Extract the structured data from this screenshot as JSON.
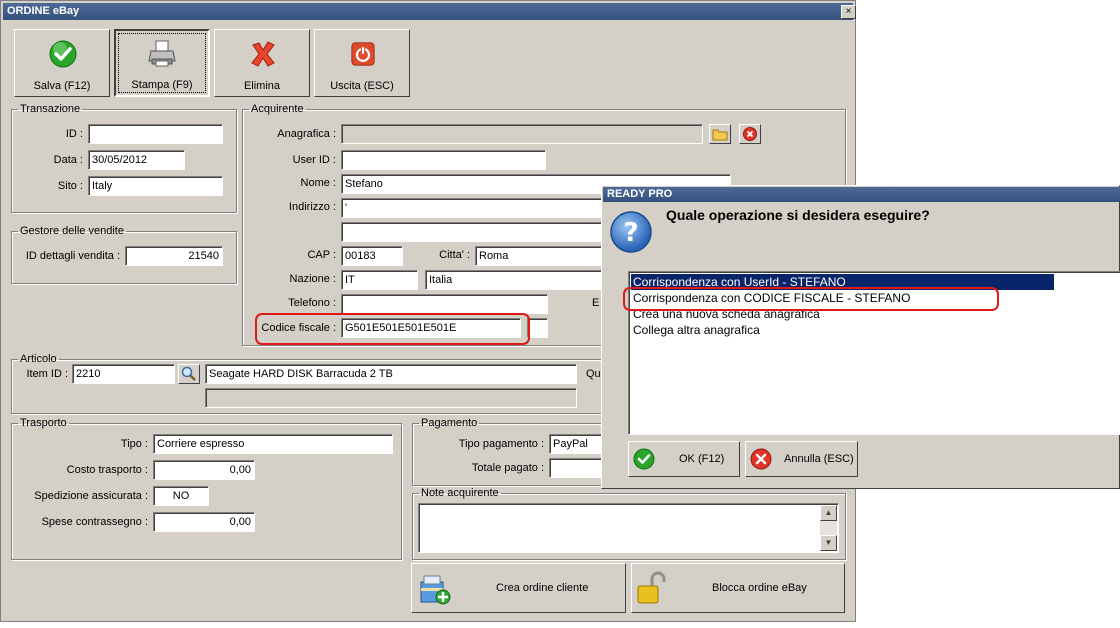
{
  "main_window": {
    "title": "ORDINE eBay",
    "close_glyph": "×"
  },
  "toolbar": {
    "save_label": "Salva (F12)",
    "print_label": "Stampa (F9)",
    "delete_label": "Elimina",
    "exit_label": "Uscita (ESC)"
  },
  "transazione": {
    "legend": "Transazione",
    "id_label": "ID :",
    "id_value": "",
    "data_label": "Data :",
    "data_value": "30/05/2012",
    "sito_label": "Sito :",
    "sito_value": "Italy"
  },
  "gestore": {
    "legend": "Gestore delle vendite",
    "id_dettagli_label": "ID dettagli vendita :",
    "id_dettagli_value": "21540"
  },
  "acquirente": {
    "legend": "Acquirente",
    "anagrafica_label": "Anagrafica :",
    "anagrafica_value": "",
    "userid_label": "User ID :",
    "userid_value": "",
    "nome_label": "Nome :",
    "nome_value": "Stefano",
    "indirizzo_label": "Indirizzo :",
    "indirizzo_value": "'",
    "indirizzo2_value": "",
    "cap_label": "CAP :",
    "cap_value": "00183",
    "citta_label": "Citta' :",
    "citta_value": "Roma",
    "nazione_label": "Nazione :",
    "nazione_code": "IT",
    "nazione_name": "Italia",
    "telefono_label": "Telefono :",
    "telefono_value": "",
    "email_label_partial": "E",
    "codice_fiscale_label": "Codice fiscale :",
    "codice_fiscale_value": "G501E501E501E501E",
    "codice_extra_value": ""
  },
  "articolo": {
    "legend": "Articolo",
    "item_id_label": "Item ID :",
    "item_id_value": "2210",
    "title_value": "Seagate HARD DISK Barracuda 2 TB",
    "subtitle_value": "",
    "qty_label_partial": "Qu"
  },
  "trasporto": {
    "legend": "Trasporto",
    "tipo_label": "Tipo :",
    "tipo_value": "Corriere espresso",
    "costo_label": "Costo trasporto :",
    "costo_value": "0,00",
    "assicurata_label": "Spedizione assicurata :",
    "assicurata_value": "NO",
    "contrassegno_label": "Spese contrassegno :",
    "contrassegno_value": "0,00"
  },
  "pagamento": {
    "legend": "Pagamento",
    "tipo_label": "Tipo pagamento :",
    "tipo_value": "PayPal",
    "totale_label": "Totale pagato :",
    "totale_value": ""
  },
  "note": {
    "legend": "Note acquirente",
    "value": ""
  },
  "actions": {
    "crea_ordine_label": "Crea ordine cliente",
    "blocca_ordine_label": "Blocca ordine eBay"
  },
  "dialog": {
    "title": "READY PRO",
    "question": "Quale operazione si desidera eseguire?",
    "options": [
      "Corrispondenza con UserId - STEFANO",
      "Corrispondenza con CODICE FISCALE - STEFANO",
      "Crea una nuova scheda anagrafica",
      "Collega altra anagrafica"
    ],
    "selected_index": 0,
    "ok_label": "OK (F12)",
    "cancel_label": "Annulla (ESC)"
  },
  "colors": {
    "window_bg": "#d4d0c8",
    "titlebar": "#34517e",
    "selection": "#0a246a",
    "highlight_annotation": "#e01818"
  }
}
